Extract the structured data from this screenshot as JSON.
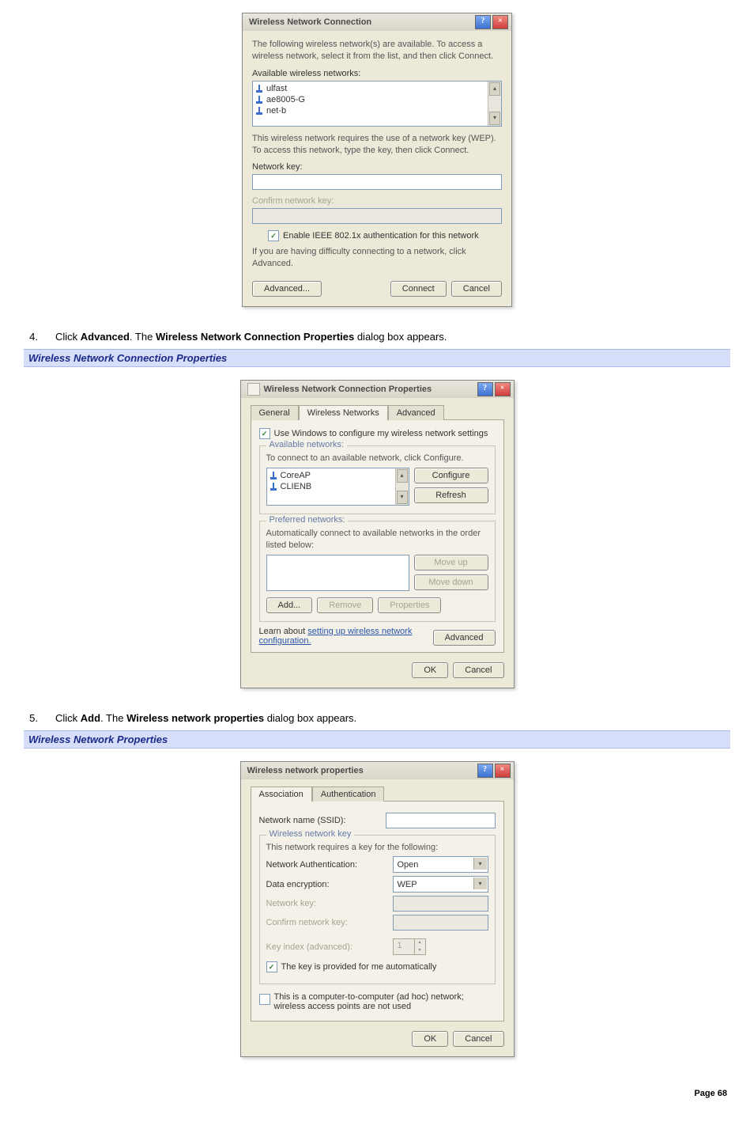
{
  "dialog1": {
    "title": "Wireless Network Connection",
    "intro": "The following wireless network(s) are available. To access a wireless network, select it from the list, and then click Connect.",
    "available_label": "Available wireless networks:",
    "networks": [
      "ulfast",
      "ae8005-G",
      "net-b"
    ],
    "wep_text": "This wireless network requires the use of a network key (WEP). To access this network, type the key, then click Connect.",
    "network_key_label": "Network key:",
    "confirm_key_label": "Confirm network key:",
    "ieee_label": "Enable IEEE 802.1x authentication for this network",
    "advanced_hint": "If you are having difficulty connecting to a network, click Advanced.",
    "advanced_btn": "Advanced...",
    "connect_btn": "Connect",
    "cancel_btn": "Cancel"
  },
  "step4": {
    "num": "4.",
    "prefix": "Click ",
    "bold1": "Advanced",
    "mid": ". The ",
    "bold2": "Wireless Network Connection Properties",
    "suffix": " dialog box appears."
  },
  "heading1": "Wireless Network Connection Properties",
  "dialog2": {
    "title": "Wireless Network Connection Properties",
    "tabs": {
      "general": "General",
      "wireless": "Wireless Networks",
      "advanced": "Advanced"
    },
    "use_windows": "Use Windows to configure my wireless network settings",
    "available_legend": "Available networks:",
    "available_text": "To connect to an available network, click Configure.",
    "available_items": [
      "CoreAP",
      "CLIENB"
    ],
    "configure_btn": "Configure",
    "refresh_btn": "Refresh",
    "preferred_legend": "Preferred networks:",
    "preferred_text": "Automatically connect to available networks in the order listed below:",
    "moveup_btn": "Move up",
    "movedown_btn": "Move down",
    "add_btn": "Add...",
    "remove_btn": "Remove",
    "properties_btn": "Properties",
    "learn_label": "Learn about ",
    "learn_link": "setting up wireless network configuration.",
    "advanced_btn": "Advanced",
    "ok_btn": "OK",
    "cancel_btn": "Cancel"
  },
  "step5": {
    "num": "5.",
    "prefix": "Click ",
    "bold1": "Add",
    "mid": ". The ",
    "bold2": "Wireless network properties",
    "suffix": " dialog box appears."
  },
  "heading2": "Wireless Network Properties",
  "dialog3": {
    "title": "Wireless network properties",
    "tabs": {
      "assoc": "Association",
      "auth": "Authentication"
    },
    "ssid_label": "Network name (SSID):",
    "group_legend": "Wireless network key",
    "req_text": "This network requires a key for the following:",
    "net_auth_label": "Network Authentication:",
    "net_auth_value": "Open",
    "data_enc_label": "Data encryption:",
    "data_enc_value": "WEP",
    "net_key_label": "Network key:",
    "confirm_key_label": "Confirm network key:",
    "key_index_label": "Key index (advanced):",
    "key_index_value": "1",
    "auto_key_label": "The key is provided for me automatically",
    "adhoc_label": "This is a computer-to-computer (ad hoc) network; wireless access points are not used",
    "ok_btn": "OK",
    "cancel_btn": "Cancel"
  },
  "footer": {
    "label": "Page ",
    "num": "68"
  }
}
